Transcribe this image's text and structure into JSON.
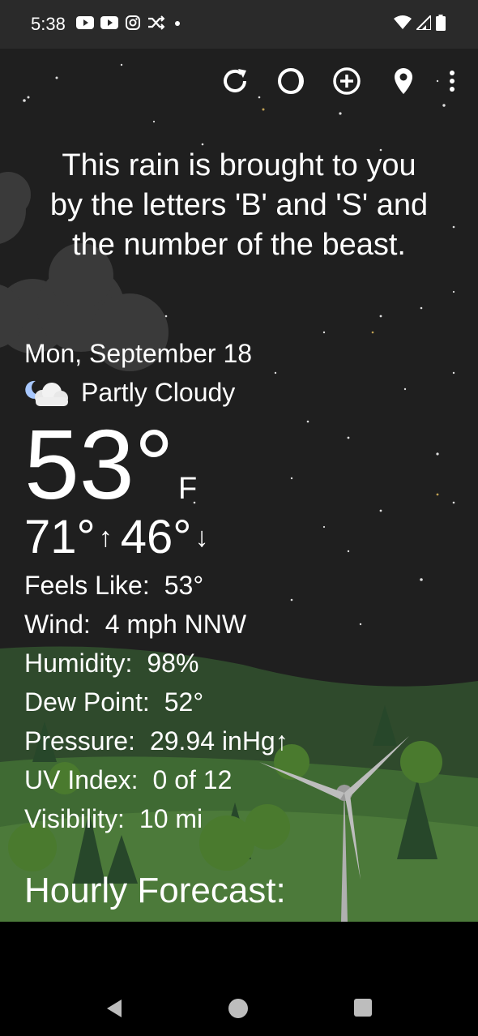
{
  "status_bar": {
    "time": "5:38",
    "left_icons": [
      "youtube-icon",
      "youtube-icon",
      "instagram-icon",
      "shuffle-icon",
      "dot-icon"
    ],
    "right_icons": [
      "wifi-icon",
      "cell-signal-icon",
      "battery-icon"
    ]
  },
  "toolbar": {
    "icons": [
      "refresh-icon",
      "moon-phase-icon",
      "add-location-icon",
      "location-pin-icon",
      "more-vert-icon"
    ]
  },
  "quote": {
    "line1": "This rain is brought to you",
    "line2": "by the letters 'B' and 'S' and",
    "line3": "the number of the beast."
  },
  "current": {
    "date": "Mon, September 18",
    "condition": "Partly Cloudy",
    "condition_icon": "partly-cloudy-night-icon",
    "temperature": "53°",
    "unit": "F",
    "high": "71°",
    "low": "46°"
  },
  "details": [
    {
      "label": "Feels Like:",
      "value": "53°"
    },
    {
      "label": "Wind:",
      "value": "4 mph NNW"
    },
    {
      "label": "Humidity:",
      "value": "98%"
    },
    {
      "label": "Dew Point:",
      "value": "52°"
    },
    {
      "label": "Pressure:",
      "value": "29.94 inHg↑"
    },
    {
      "label": "UV Index:",
      "value": "0 of 12"
    },
    {
      "label": "Visibility:",
      "value": "10 mi"
    }
  ],
  "hourly": {
    "title": "Hourly Forecast:"
  },
  "nav": {
    "icons": [
      "back-icon",
      "home-icon",
      "recents-icon"
    ]
  },
  "colors": {
    "background": "#1f1f1f",
    "hills": "#4c7a3a",
    "text": "#ffffff"
  }
}
